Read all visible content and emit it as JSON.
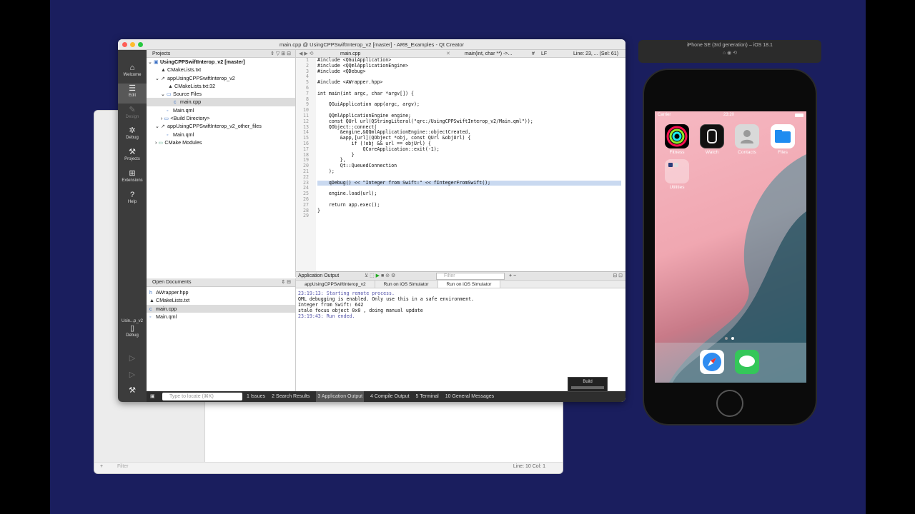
{
  "back_window": {
    "filter_placeholder": "Filter",
    "status": "Line: 10 Col: 1"
  },
  "qt": {
    "title": "main.cpp @ UsingCPPSwiftInterop_v2 [master] - ARB_Examples - Qt Creator",
    "modes": [
      {
        "label": "Welcome",
        "icon": "⌂"
      },
      {
        "label": "Edit",
        "icon": "☰"
      },
      {
        "label": "Design",
        "icon": "✎"
      },
      {
        "label": "Debug",
        "icon": "✲"
      },
      {
        "label": "Projects",
        "icon": "⚒"
      },
      {
        "label": "Extensions",
        "icon": "⊞"
      },
      {
        "label": "Help",
        "icon": "?"
      }
    ],
    "kit": {
      "project": "Usin...p_v2",
      "config": "Debug"
    },
    "projects_header": "Projects",
    "tree": [
      "UsingCPPSwiftInterop_v2 [master]",
      "CMakeLists.txt",
      "appUsingCPPSwiftInterop_v2",
      "CMakeLists.txt:32",
      "Source Files",
      "main.cpp",
      "Main.qml",
      "<Build Directory>",
      "appUsingCPPSwiftInterop_v2_other_files",
      "Main.qml",
      "CMake Modules"
    ],
    "open_docs_header": "Open Documents",
    "open_docs": [
      "AWrapper.hpp",
      "CMakeLists.txt",
      "main.cpp",
      "Main.qml"
    ],
    "editor": {
      "file": "main.cpp",
      "symbol": "main(int, char **) ->...",
      "hash": "#",
      "eol": "LF",
      "pos": "Line: 23, ... (Sel: 61)"
    },
    "code_lines": [
      "#include <QGuiApplication>",
      "#include <QQmlApplicationEngine>",
      "#include <QDebug>",
      "",
      "#include <AWrapper.hpp>",
      "",
      "int main(int argc, char *argv[]) {",
      "",
      "    QGuiApplication app(argc, argv);",
      "",
      "    QQmlApplicationEngine engine;",
      "    const QUrl url(QStringLiteral(\"qrc:/UsingCPPSwiftInterop_v2/Main.qml\"));",
      "    QObject::connect(",
      "        &engine,&QQmlApplicationEngine::objectCreated,",
      "        &app,[url](QObject *obj, const QUrl &objUrl) {",
      "            if (!obj && url == objUrl) {",
      "                QCoreApplication::exit(-1);",
      "            }",
      "        },",
      "        Qt::QueuedConnection",
      "    );",
      "",
      "    qDebug() << \"Integer from Swift:\" << fIntegerFromSwift();",
      "",
      "    engine.load(url);",
      "",
      "    return app.exec();",
      "}",
      ""
    ],
    "app_output": {
      "header": "Application Output",
      "filter_placeholder": "Filter",
      "tabs": [
        "appUsingCPPSwiftInterop_v2",
        "Run on iOS Simulator",
        "Run on iOS Simulator"
      ],
      "lines": [
        "23:19:13: Starting remote process.",
        "QML debugging is enabled. Only use this in a safe environment.",
        "Integer from Swift: 642",
        "stale focus object 0x0 , doing manual update",
        "23:19:43: Run ended."
      ]
    },
    "status": {
      "locate_placeholder": "Type to locate (⌘K)",
      "tabs": [
        "1 Issues",
        "2 Search Results",
        "3 Application Output",
        "4 Compile Output",
        "5 Terminal",
        "10 General Messages"
      ]
    },
    "build_label": "Build"
  },
  "simulator": {
    "title": "iPhone SE (3rd generation) – iOS 18.1",
    "carrier": "Carrier",
    "time": "23:20",
    "apps": [
      "Fitness",
      "Watch",
      "Contacts",
      "Files",
      "Utilities"
    ]
  }
}
